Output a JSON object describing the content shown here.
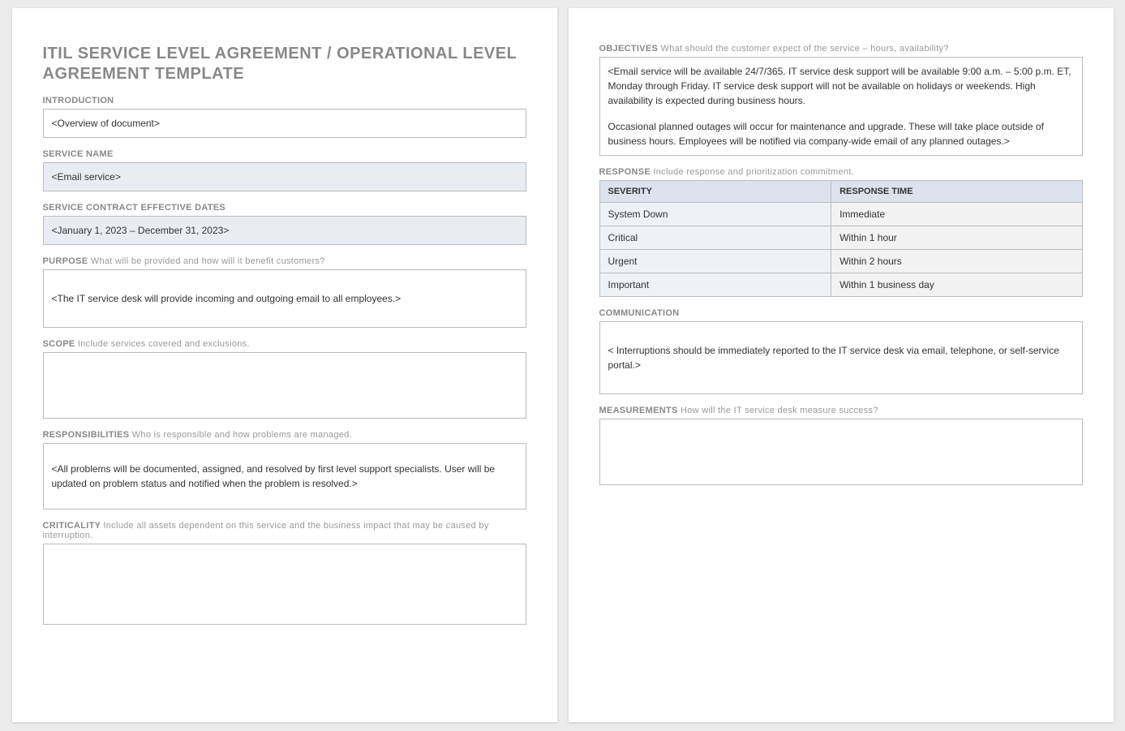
{
  "title": "ITIL SERVICE LEVEL AGREEMENT / OPERATIONAL LEVEL AGREEMENT TEMPLATE",
  "sections": {
    "introduction": {
      "label": "INTRODUCTION",
      "value": "<Overview of document>"
    },
    "service_name": {
      "label": "SERVICE NAME",
      "value": "<Email service>"
    },
    "effective_dates": {
      "label": "SERVICE CONTRACT EFFECTIVE DATES",
      "value": "<January 1, 2023 – December 31, 2023>"
    },
    "purpose": {
      "label": "PURPOSE",
      "hint": "What will be provided and how will it benefit customers?",
      "value": "<The IT service desk will provide incoming and outgoing email to all employees.>"
    },
    "scope": {
      "label": "SCOPE",
      "hint": "Include services covered and exclusions.",
      "value": ""
    },
    "responsibilities": {
      "label": "RESPONSIBILITIES",
      "hint": "Who is responsible and how problems are managed.",
      "value": "<All problems will be documented, assigned, and resolved by first level support specialists. User will be updated on problem status and notified when the problem is resolved.>"
    },
    "criticality": {
      "label": "CRITICALITY",
      "hint": "Include all assets dependent on this service and the business impact that may be caused by interruption.",
      "value": ""
    },
    "objectives": {
      "label": "OBJECTIVES",
      "hint": "What should the customer expect of the service – hours, availability?",
      "para1": "<Email service will be available 24/7/365. IT service desk support will be available 9:00 a.m. – 5:00 p.m. ET, Monday through Friday. IT service desk support will not be available on holidays or weekends. High availability is expected during business hours.",
      "para2": "Occasional planned outages will occur for maintenance and upgrade. These will take place outside of business hours. Employees will be notified via company-wide email of any planned outages.>"
    },
    "response": {
      "label": "RESPONSE",
      "hint": "Include response and prioritization commitment.",
      "headers": {
        "severity": "SEVERITY",
        "response_time": "RESPONSE TIME"
      },
      "rows": [
        {
          "severity": "System Down",
          "response_time": "Immediate"
        },
        {
          "severity": "Critical",
          "response_time": "Within 1 hour"
        },
        {
          "severity": "Urgent",
          "response_time": "Within 2 hours"
        },
        {
          "severity": "Important",
          "response_time": "Within 1 business day"
        }
      ]
    },
    "communication": {
      "label": "COMMUNICATION",
      "value": "< Interruptions should be immediately reported to the IT service desk via email, telephone, or self-service portal.>"
    },
    "measurements": {
      "label": "MEASUREMENTS",
      "hint": "How will the IT service desk measure success?",
      "value": ""
    }
  }
}
